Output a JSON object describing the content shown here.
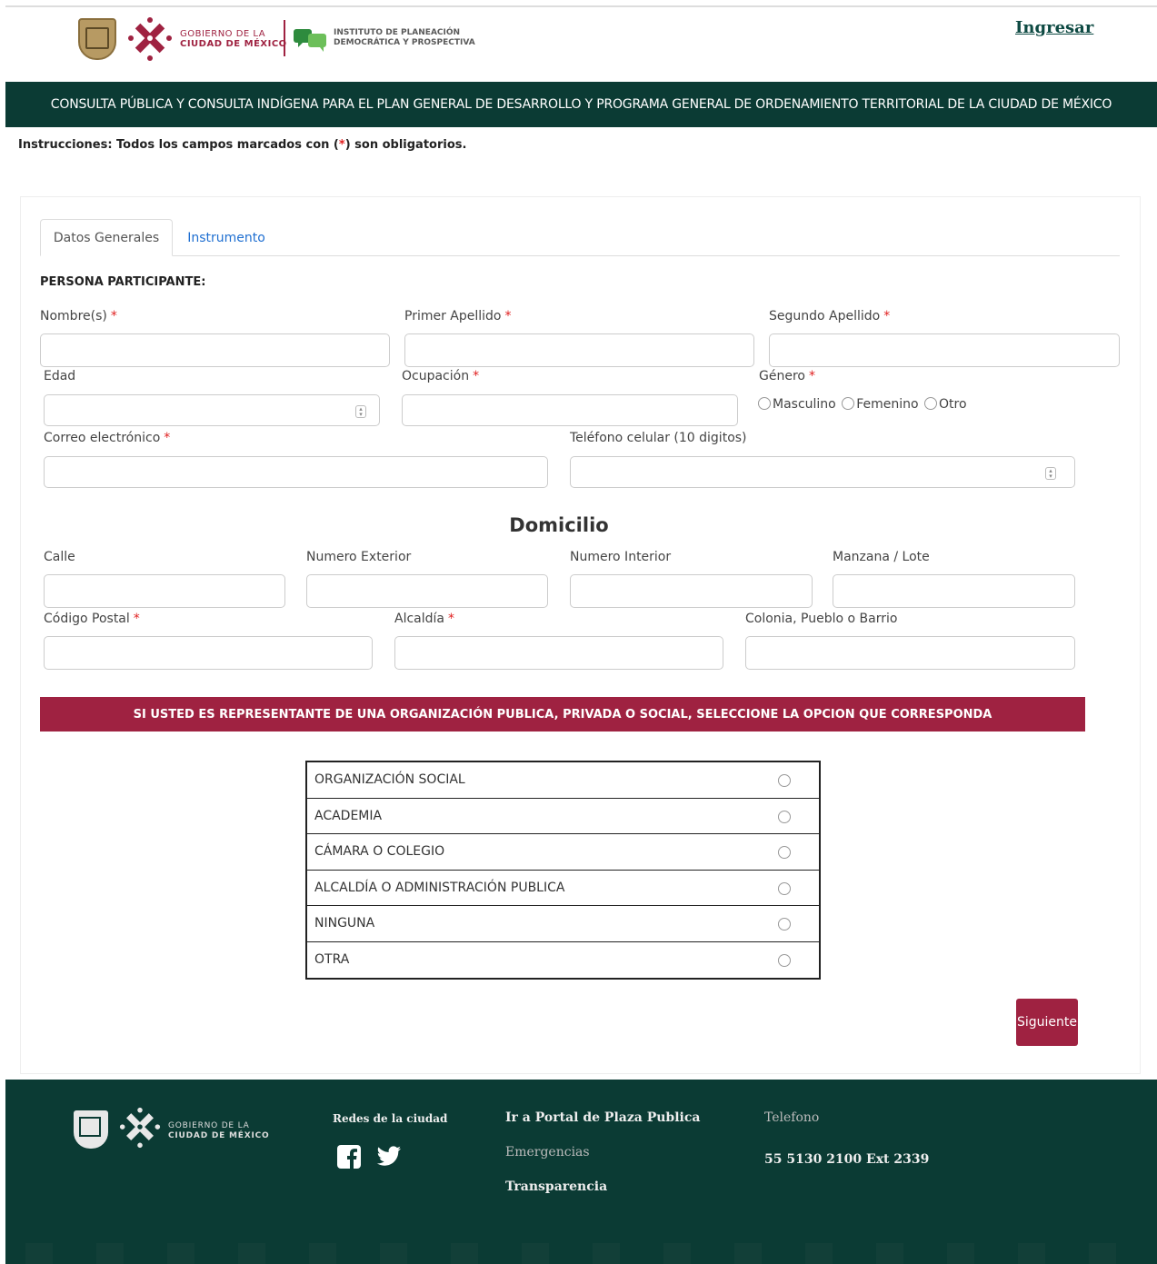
{
  "header": {
    "gobierno_line1": "GOBIERNO DE LA",
    "gobierno_line2": "CIUDAD DE MÉXICO",
    "instituto_line1": "INSTITUTO DE PLANEACIÓN",
    "instituto_line2": "DEMOCRÁTICA Y PROSPECTIVA",
    "login_label": "Ingresar"
  },
  "banner": {
    "title": "CONSULTA PÚBLICA Y CONSULTA INDÍGENA PARA EL PLAN GENERAL DE DESARROLLO Y PROGRAMA GENERAL DE ORDENAMIENTO TERRITORIAL DE LA CIUDAD DE MÉXICO"
  },
  "instructions": {
    "prefix": "Instrucciones: Todos los campos marcados con (",
    "mark": "*",
    "suffix": ") son obligatorios."
  },
  "tabs": [
    {
      "label": "Datos Generales",
      "active": true
    },
    {
      "label": "Instrumento",
      "active": false
    }
  ],
  "form": {
    "section_title": "PERSONA PARTICIPANTE:",
    "required_mark": "*",
    "fields": {
      "nombre": {
        "label": "Nombre(s)",
        "value": ""
      },
      "primer_apellido": {
        "label": "Primer Apellido",
        "value": ""
      },
      "segundo_apellido": {
        "label": "Segundo Apellido",
        "value": ""
      },
      "edad": {
        "label": "Edad",
        "value": ""
      },
      "ocupacion": {
        "label": "Ocupación",
        "value": ""
      },
      "genero": {
        "label": "Género",
        "options": [
          "Masculino",
          "Femenino",
          "Otro"
        ]
      },
      "correo": {
        "label": "Correo electrónico",
        "value": ""
      },
      "telefono": {
        "label": "Teléfono celular (10 digitos)",
        "value": ""
      }
    },
    "domicilio": {
      "title": "Domicilio",
      "calle": {
        "label": "Calle",
        "value": ""
      },
      "numero_exterior": {
        "label": "Numero Exterior",
        "value": ""
      },
      "numero_interior": {
        "label": "Numero Interior",
        "value": ""
      },
      "manzana_lote": {
        "label": "Manzana / Lote",
        "value": ""
      },
      "codigo_postal": {
        "label": "Código Postal",
        "value": ""
      },
      "alcaldia": {
        "label": "Alcaldía",
        "value": ""
      },
      "colonia": {
        "label": "Colonia, Pueblo o Barrio",
        "value": ""
      }
    }
  },
  "organization": {
    "banner": "SI USTED ES REPRESENTANTE DE UNA ORGANIZACIÓN PUBLICA, PRIVADA O SOCIAL, SELECCIONE LA OPCION QUE CORRESPONDA",
    "options": [
      "ORGANIZACIÓN SOCIAL",
      "ACADEMIA",
      "CÁMARA O COLEGIO",
      "ALCALDÍA O ADMINISTRACIÓN PUBLICA",
      "NINGUNA",
      "OTRA"
    ]
  },
  "next_button": "Siguiente",
  "footer": {
    "gobierno_line1": "GOBIERNO DE LA",
    "gobierno_line2": "CIUDAD DE MÉXICO",
    "social_heading": "Redes de la ciudad",
    "portal_link": "Ir a Portal de Plaza Publica",
    "emergencias_link": "Emergencias",
    "transparencia_link": "Transparencia",
    "phone_heading": "Telefono",
    "phone_number": "55 5130 2100 Ext 2339"
  },
  "colors": {
    "primary_green": "#0b3b34",
    "accent_maroon": "#9f2241",
    "link_blue": "#1f6fd1",
    "required_red": "#e02020"
  },
  "icons": [
    "shield-icon",
    "cdmx-logo-icon",
    "ipdp-logo-icon",
    "spinner-icon",
    "facebook-icon",
    "twitter-icon"
  ]
}
